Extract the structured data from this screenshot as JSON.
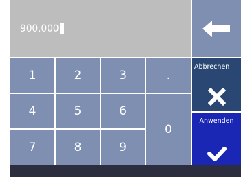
{
  "display": {
    "value": "900.000"
  },
  "keypad": {
    "k1": "1",
    "k2": "2",
    "k3": "3",
    "dot": ".",
    "k4": "4",
    "k5": "5",
    "k6": "6",
    "k7": "7",
    "k8": "8",
    "k9": "9",
    "k0": "0"
  },
  "actions": {
    "cancel_label": "Abbrechen",
    "apply_label": "Anwenden"
  },
  "icons": {
    "backspace": "arrow-left-icon",
    "cancel": "close-icon",
    "apply": "checkmark-icon"
  },
  "colors": {
    "display_bg": "#bdbdbd",
    "key_bg": "#7e8fb1",
    "cancel_bg": "#2a4774",
    "apply_bg": "#1a26b4",
    "bottom_bar": "#2c2d3f"
  }
}
